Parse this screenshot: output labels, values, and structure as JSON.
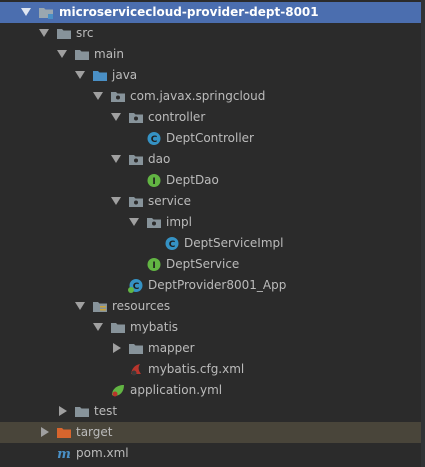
{
  "colors": {
    "background": "#2b2b2b",
    "selection": "#4b6eaf",
    "excluded_row": "#49453a",
    "folder": "#87939a",
    "source_folder": "#4a90c6",
    "excluded_folder": "#d7652d",
    "class_icon": "#3592c4",
    "interface_icon": "#62b543",
    "text": "#bbbbbb"
  },
  "tree": {
    "items": [
      {
        "label": "microservicecloud-provider-dept-8001",
        "icon": "module-folder-icon",
        "expanded": true,
        "selected": true
      },
      {
        "label": "src",
        "icon": "folder-icon",
        "expanded": true
      },
      {
        "label": "main",
        "icon": "folder-icon",
        "expanded": true
      },
      {
        "label": "java",
        "icon": "source-root-folder-icon",
        "expanded": true
      },
      {
        "label": "com.javax.springcloud",
        "icon": "package-icon",
        "expanded": true
      },
      {
        "label": "controller",
        "icon": "package-icon",
        "expanded": true
      },
      {
        "label": "DeptController",
        "icon": "class-icon"
      },
      {
        "label": "dao",
        "icon": "package-icon",
        "expanded": true
      },
      {
        "label": "DeptDao",
        "icon": "interface-icon"
      },
      {
        "label": "service",
        "icon": "package-icon",
        "expanded": true
      },
      {
        "label": "impl",
        "icon": "package-icon",
        "expanded": true
      },
      {
        "label": "DeptServiceImpl",
        "icon": "class-icon"
      },
      {
        "label": "DeptService",
        "icon": "interface-icon"
      },
      {
        "label": "DeptProvider8001_App",
        "icon": "spring-boot-class-icon"
      },
      {
        "label": "resources",
        "icon": "resources-folder-icon",
        "expanded": true
      },
      {
        "label": "mybatis",
        "icon": "folder-icon",
        "expanded": true
      },
      {
        "label": "mapper",
        "icon": "folder-icon",
        "expanded": false
      },
      {
        "label": "mybatis.cfg.xml",
        "icon": "mybatis-xml-icon"
      },
      {
        "label": "application.yml",
        "icon": "spring-yml-icon"
      },
      {
        "label": "test",
        "icon": "folder-icon",
        "expanded": false
      },
      {
        "label": "target",
        "icon": "excluded-folder-icon",
        "expanded": false,
        "excluded": true
      },
      {
        "label": "pom.xml",
        "icon": "maven-icon"
      }
    ]
  }
}
